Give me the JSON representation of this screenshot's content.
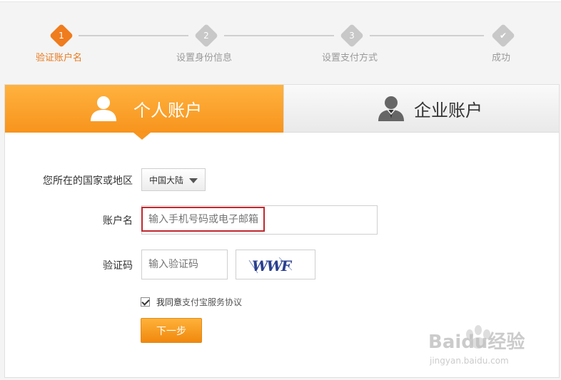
{
  "steps": [
    {
      "number": "1",
      "label": "验证账户名",
      "state": "active"
    },
    {
      "number": "2",
      "label": "设置身份信息",
      "state": "inactive"
    },
    {
      "number": "3",
      "label": "设置支付方式",
      "state": "inactive"
    },
    {
      "number": "✔",
      "label": "成功",
      "state": "inactive"
    }
  ],
  "tabs": {
    "personal": {
      "label": "个人账户",
      "icon": "person-icon"
    },
    "business": {
      "label": "企业账户",
      "icon": "business-person-icon"
    }
  },
  "form": {
    "region_label": "您所在的国家或地区",
    "region_value": "中国大陆",
    "account_label": "账户名",
    "account_placeholder": "输入手机号码或电子邮箱",
    "captcha_label": "验证码",
    "captcha_placeholder": "输入验证码",
    "captcha_text": "WWF",
    "agree_prefix": "我同意",
    "agree_link": "支付宝服务协议",
    "agree_checked": true,
    "next_button": "下一步"
  },
  "colors": {
    "accent": "#f7941d",
    "active_step": "#ef7c1d",
    "highlight_border": "#c0282e"
  },
  "watermark": {
    "brand": "Baidu经验",
    "url": "jingyan.baidu.com"
  }
}
